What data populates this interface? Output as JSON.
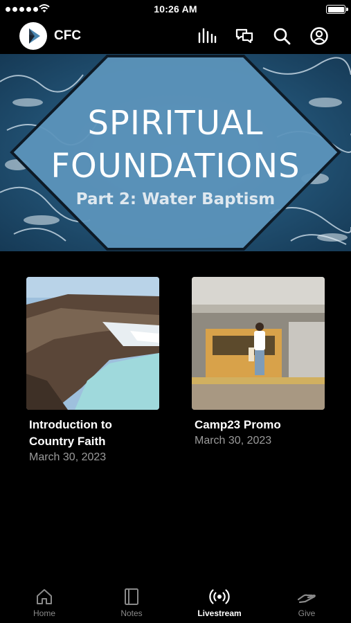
{
  "status_bar": {
    "time": "10:26 AM"
  },
  "header": {
    "app_name": "CFC",
    "icons": [
      "bar-chart-icon",
      "chat-icon",
      "search-icon",
      "profile-icon"
    ]
  },
  "hero": {
    "title_line1": "SPIRITUAL",
    "title_line2": "FOUNDATIONS",
    "subtitle": "Part 2: Water Baptism"
  },
  "videos": [
    {
      "title_line1": "Introduction to",
      "title_line2": "Country Faith",
      "date": "March 30, 2023"
    },
    {
      "title_line1": "Camp23 Promo",
      "title_line2": "",
      "date": "March 30, 2023"
    }
  ],
  "tabs": [
    {
      "label": "Home",
      "icon": "home-icon",
      "active": false
    },
    {
      "label": "Notes",
      "icon": "notes-icon",
      "active": false
    },
    {
      "label": "Livestream",
      "icon": "livestream-icon",
      "active": true
    },
    {
      "label": "Give",
      "icon": "give-icon",
      "active": false
    }
  ],
  "colors": {
    "background": "#000000",
    "accent_blue": "#4a86b0",
    "inactive_tab": "#8a8a8a"
  }
}
